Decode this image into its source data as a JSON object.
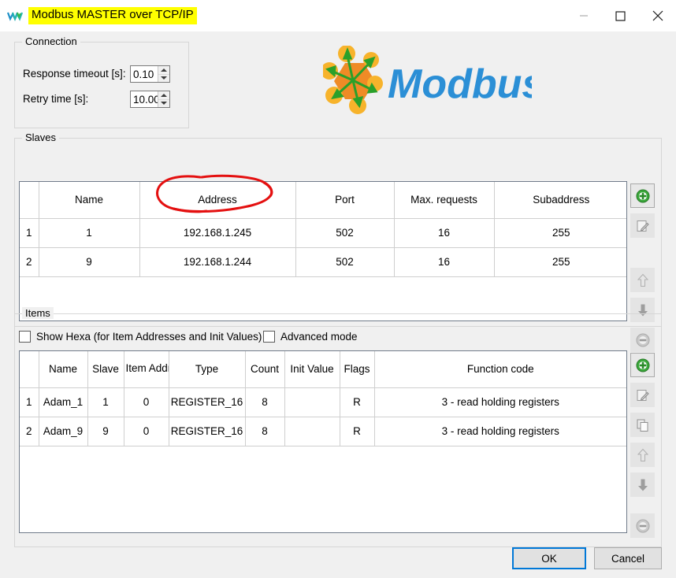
{
  "window": {
    "title": "Modbus MASTER over TCP/IP",
    "title_highlight_color": "#ffff00",
    "app_icon": "modbus-w-logo-icon",
    "minimize_label": "minimize-icon",
    "maximize_label": "maximize-icon",
    "close_label": "close-icon"
  },
  "connection": {
    "legend": "Connection",
    "response_timeout_label": "Response timeout [s]:",
    "response_timeout_value": "0.10",
    "retry_time_label": "Retry time [s]:",
    "retry_time_value": "10.00"
  },
  "logo": {
    "text": "Modbus",
    "text_color": "#2b8fd6",
    "node_color": "#f5a623",
    "hub_color": "#ef8b26",
    "arrow_color": "#2aa02a"
  },
  "slaves": {
    "legend": "Slaves",
    "columns": [
      "",
      "Name",
      "Address",
      "Port",
      "Max. requests",
      "Subaddress"
    ],
    "rows": [
      {
        "index": "1",
        "name": "1",
        "address": "192.168.1.245",
        "port": "502",
        "max_requests": "16",
        "subaddress": "255"
      },
      {
        "index": "2",
        "name": "9",
        "address": "192.168.1.244",
        "port": "502",
        "max_requests": "16",
        "subaddress": "255"
      }
    ],
    "buttons": [
      {
        "name": "add-slave-button",
        "icon": "plus-circle-icon",
        "enabled": true
      },
      {
        "name": "edit-slave-button",
        "icon": "edit-icon",
        "enabled": false
      },
      {
        "name": "move-slave-up-button",
        "icon": "arrow-up-icon",
        "enabled": false
      },
      {
        "name": "move-slave-down-button",
        "icon": "arrow-down-icon",
        "enabled": false
      },
      {
        "name": "remove-slave-button",
        "icon": "minus-circle-icon",
        "enabled": false
      }
    ]
  },
  "items": {
    "legend": "Items",
    "show_hexa_label": "Show Hexa (for Item Addresses and Init Values)",
    "show_hexa_checked": false,
    "advanced_mode_label": "Advanced mode",
    "advanced_mode_checked": false,
    "columns": [
      "",
      "Name",
      "Slave",
      "Item Address",
      "Type",
      "Count",
      "Init Value",
      "Flags",
      "Function code"
    ],
    "rows": [
      {
        "index": "1",
        "name": "Adam_1",
        "slave": "1",
        "item_address": "0",
        "type": "REGISTER_16",
        "count": "8",
        "init_value": "",
        "flags": "R",
        "function_code": "3 - read holding registers"
      },
      {
        "index": "2",
        "name": "Adam_9",
        "slave": "9",
        "item_address": "0",
        "type": "REGISTER_16",
        "count": "8",
        "init_value": "",
        "flags": "R",
        "function_code": "3 - read holding registers"
      }
    ],
    "buttons": [
      {
        "name": "add-item-button",
        "icon": "plus-circle-icon",
        "enabled": true
      },
      {
        "name": "edit-item-button",
        "icon": "edit-icon",
        "enabled": false
      },
      {
        "name": "copy-item-button",
        "icon": "copy-icon",
        "enabled": false
      },
      {
        "name": "move-item-up-button",
        "icon": "arrow-up-icon",
        "enabled": false
      },
      {
        "name": "move-item-down-button",
        "icon": "arrow-down-icon",
        "enabled": false
      },
      {
        "name": "remove-item-button",
        "icon": "minus-circle-icon",
        "enabled": false
      }
    ]
  },
  "footer": {
    "ok_label": "OK",
    "cancel_label": "Cancel",
    "focus_color": "#0078d7"
  },
  "annotation": {
    "type": "hand-drawn-ellipse",
    "color": "#e41010",
    "targets": "192.168.1.245"
  }
}
